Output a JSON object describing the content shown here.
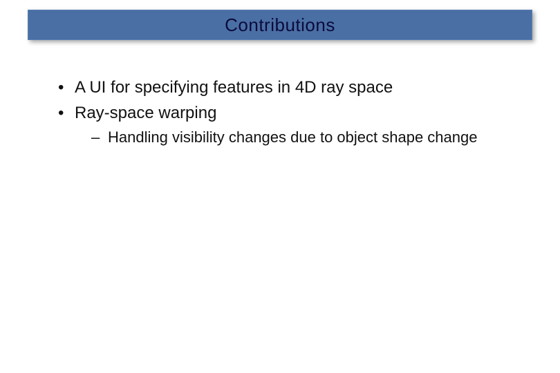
{
  "title": "Contributions",
  "bullets": {
    "level1": [
      {
        "text": "A UI for specifying features in 4D ray space"
      },
      {
        "text": "Ray-space warping"
      }
    ],
    "level2_under_1": [
      {
        "text": "Handling visibility changes due to object shape change"
      }
    ]
  }
}
